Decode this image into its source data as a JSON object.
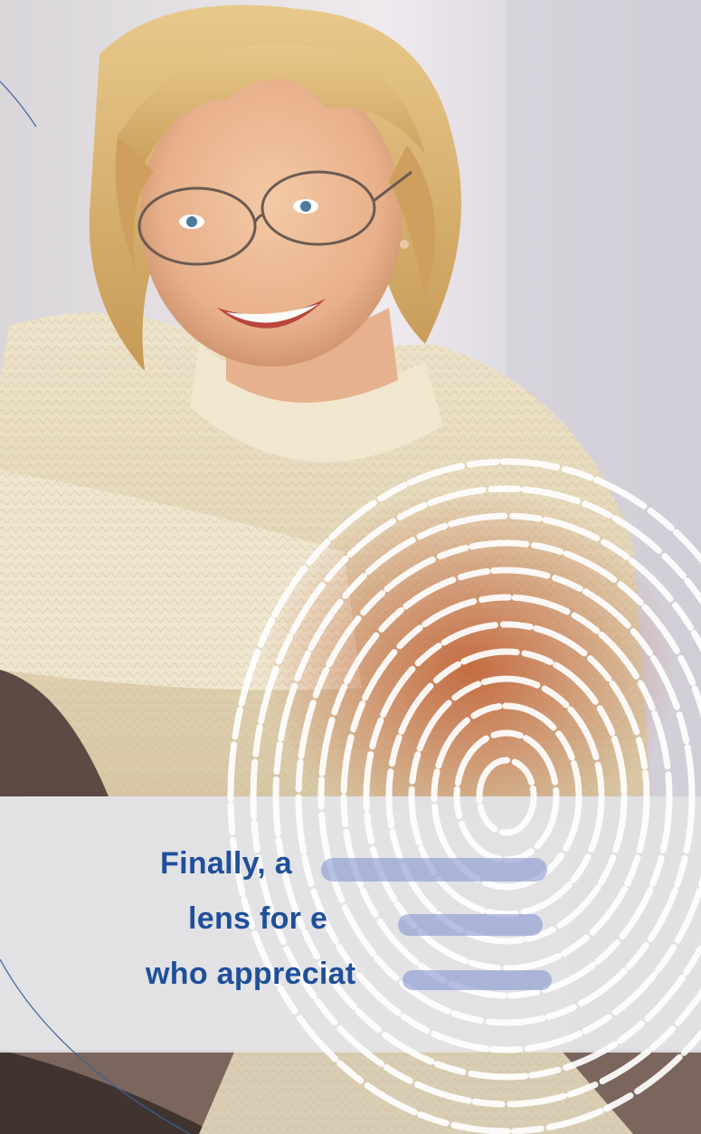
{
  "headline": {
    "line1": "Finally, a",
    "line2": "lens for e",
    "line3": "who appreciat"
  },
  "colors": {
    "headline": "#1f4f9b",
    "band": "#e2e2e4",
    "sweater": "#e9dcc0",
    "hair": "#d9b36a",
    "background": "#e4e1e6"
  },
  "image": {
    "subject": "woman-wearing-glasses",
    "overlay": "fingerprint-graphic"
  }
}
